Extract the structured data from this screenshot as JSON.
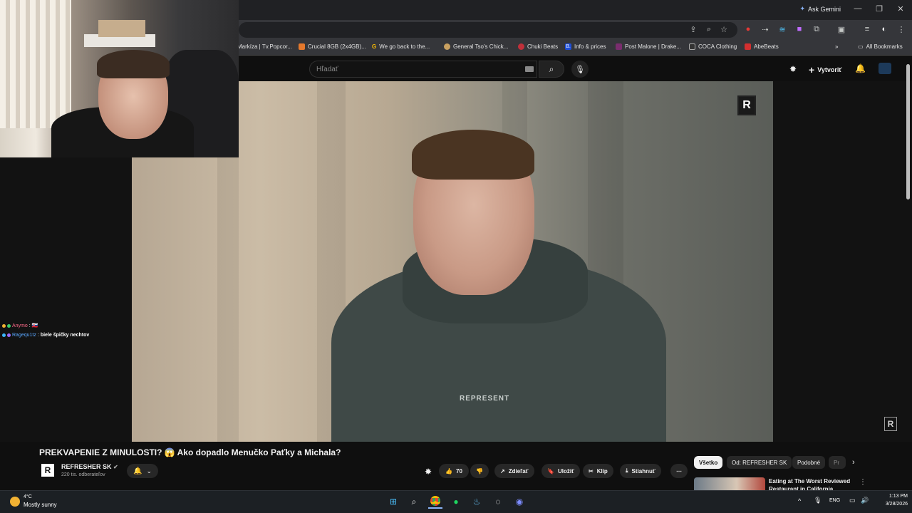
{
  "browser": {
    "ask_gemini": "Ask Gemini",
    "bookmarks": [
      {
        "label": "Markíza | Tv.Popcor...",
        "color": "#d0451b"
      },
      {
        "label": "Crucial 8GB (2x4GB)...",
        "color": "#e4782c"
      },
      {
        "label": "We go back to the...",
        "color": "#fbbc04"
      },
      {
        "label": "General Tso's Chick...",
        "color": "#c8a060"
      },
      {
        "label": "Chuki Beats",
        "color": "#c0303a"
      },
      {
        "label": "Info & prices",
        "color": "#1d4ed8"
      },
      {
        "label": "Post Malone | Drake...",
        "color": "#7a2d6e"
      },
      {
        "label": "COCA Clothing",
        "color": "#333333"
      },
      {
        "label": "AbeBeats",
        "color": "#d32f2f"
      }
    ],
    "all_bookmarks": "All Bookmarks"
  },
  "youtube": {
    "search_placeholder": "Hľadať",
    "create_label": "Vytvoriť",
    "video_title": "PREKVAPENIE Z MINULOSTI? 😱 Ako dopadlo Menučko Paťky a Michala?",
    "channel_name": "REFRESHER SK",
    "channel_subs": "220 tis. odberateľov",
    "like_count": "70",
    "actions": {
      "share": "Zdieľať",
      "save": "Uložiť",
      "clip": "Klip",
      "download": "Stiahnuť"
    },
    "chips": [
      "Všetko",
      "Od: REFRESHER SK",
      "Podobné",
      "Pr"
    ],
    "recommended_title": "Eating at The Worst Reviewed Restaurant in California",
    "shirt_text": "REPRESENT",
    "watermark": "R"
  },
  "chat": [
    {
      "user": "Anymo",
      "message": "🇸🇰",
      "user_color": "#ff6b8a"
    },
    {
      "user": "Ragequ1tz",
      "message": "biele špičky nechtov",
      "user_color": "#5aa7ff"
    }
  ],
  "taskbar": {
    "temperature": "4°C",
    "condition": "Mostly sunny",
    "language": "ENG",
    "time": "1:13 PM",
    "date": "3/28/2026"
  }
}
